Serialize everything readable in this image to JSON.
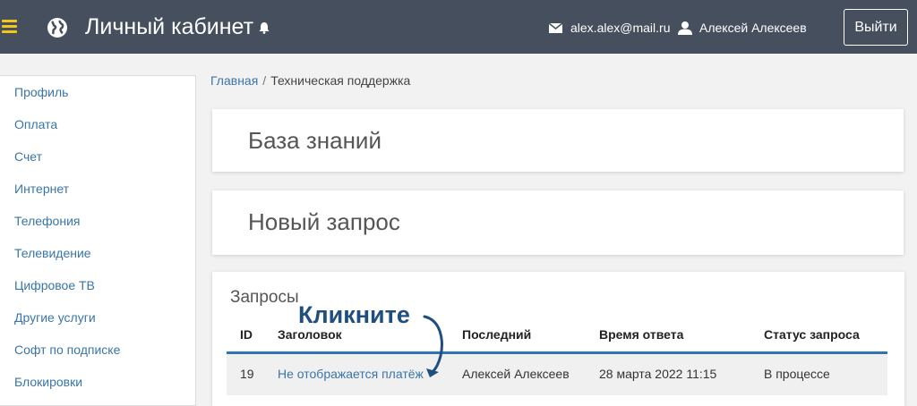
{
  "header": {
    "title": "Личный кабинет",
    "email": "alex.alex@mail.ru",
    "username": "Алексей Алексеев",
    "logout_label": "Выйти",
    "colors": {
      "bar": "#454f5e",
      "menu_accent": "#f5c518"
    },
    "icons": [
      "menu-icon",
      "globe-icon",
      "bell-icon",
      "mail-icon",
      "user-icon"
    ]
  },
  "sidebar": {
    "items": [
      {
        "label": "Профиль"
      },
      {
        "label": "Оплата"
      },
      {
        "label": "Счет"
      },
      {
        "label": "Интернет"
      },
      {
        "label": "Телефония"
      },
      {
        "label": "Телевидение"
      },
      {
        "label": "Цифровое ТВ"
      },
      {
        "label": "Другие услуги"
      },
      {
        "label": "Софт по подписке"
      },
      {
        "label": "Блокировки"
      }
    ]
  },
  "breadcrumb": {
    "home": "Главная",
    "separator": "/",
    "current": "Техническая поддержка"
  },
  "sections": {
    "knowledge_base": "База знаний",
    "new_request": "Новый запрос"
  },
  "requests": {
    "title": "Запросы",
    "columns": [
      "ID",
      "Заголовок",
      "Последний",
      "Время ответа",
      "Статус запроса"
    ],
    "rows": [
      {
        "id": "19",
        "subject": "Не отображается платёж",
        "last": "Алексей Алексеев",
        "time": "28 марта 2022 11:15",
        "status": "В процессе"
      }
    ],
    "accent_color": "#2f74b5"
  },
  "annotation": {
    "text": "Кликните",
    "color": "#1f4f80"
  }
}
